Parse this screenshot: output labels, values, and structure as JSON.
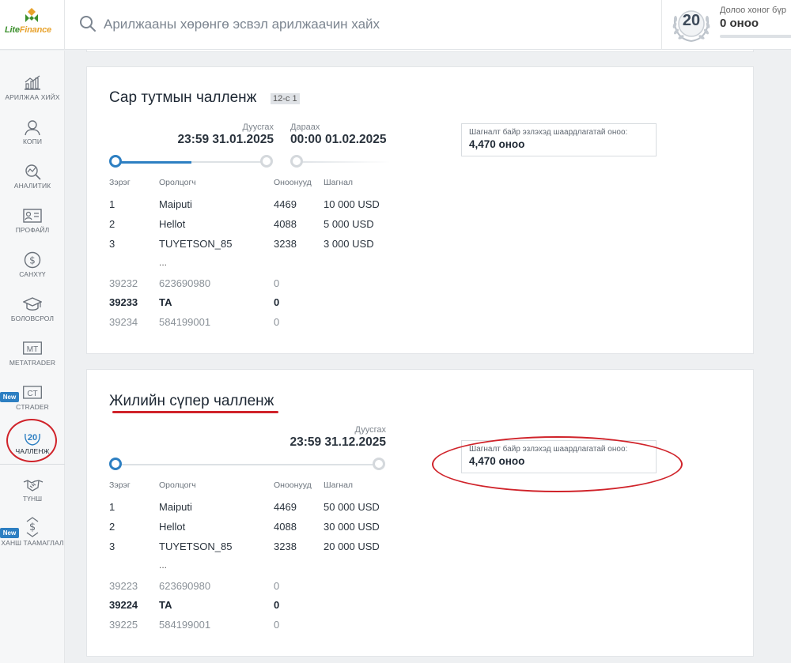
{
  "brand": {
    "logo_word1": "Lite",
    "logo_word2": "Finance"
  },
  "search": {
    "placeholder": "Арилжааны хөрөнгө эсвэл арилжаачин хайх"
  },
  "weekly": {
    "badge_number": "20",
    "label": "Долоо хоног бүр",
    "points": "0 оноо",
    "progress": 0
  },
  "sidebar": {
    "items": [
      {
        "label": "АРИЛЖАА ХИЙХ",
        "icon": "chart-icon"
      },
      {
        "label": "КОПИ",
        "icon": "user-icon"
      },
      {
        "label": "АНАЛИТИК",
        "icon": "analytics-icon"
      },
      {
        "label": "ПРОФАЙЛ",
        "icon": "profile-card-icon"
      },
      {
        "label": "САНХҮҮ",
        "icon": "dollar-icon"
      },
      {
        "label": "БОЛОВСРОЛ",
        "icon": "graduation-cap-icon"
      },
      {
        "label": "METATRADER",
        "icon_text": "MT"
      },
      {
        "label": "CTRADER",
        "icon_text": "CT",
        "badge": "New"
      },
      {
        "label": "ЧАЛЛЕНЖ",
        "icon_text": "20",
        "active": true
      },
      {
        "label": "ТҮНШ",
        "icon": "handshake-icon"
      },
      {
        "label": "ХАНШ ТААМАГЛАЛ",
        "icon": "prediction-icon",
        "badge": "New"
      }
    ]
  },
  "monthly": {
    "title": "Сар тутмын чалленж",
    "level": "12-с 1",
    "end_label": "Дуусгах",
    "end_value": "23:59 31.01.2025",
    "next_label": "Дараах",
    "next_value": "00:00 01.02.2025",
    "progress": 0.5,
    "headers": {
      "rank": "Зэрэг",
      "participant": "Оролцогч",
      "points": "Оноонууд",
      "prize": "Шагнал"
    },
    "top_rows": [
      {
        "rank": "1",
        "name": "Maiputi",
        "points": "4469",
        "prize": "10 000 USD"
      },
      {
        "rank": "2",
        "name": "Hellot",
        "points": "4088",
        "prize": "5 000 USD"
      },
      {
        "rank": "3",
        "name": "TUYETSON_85",
        "points": "3238",
        "prize": "3 000 USD"
      }
    ],
    "ellipsis": "...",
    "around_rows": [
      {
        "rank": "39232",
        "name": "623690980",
        "points": "0",
        "style": "muted"
      },
      {
        "rank": "39233",
        "name": "ТА",
        "points": "0",
        "style": "bold"
      },
      {
        "rank": "39234",
        "name": "584199001",
        "points": "0",
        "style": "muted"
      }
    ],
    "req_label": "Шагналт байр эзлэхэд шаардлагатай оноо:",
    "req_value": "4,470 оноо"
  },
  "yearly": {
    "title": "Жилийн сүпер чалленж",
    "end_label": "Дуусгах",
    "end_value": "23:59 31.12.2025",
    "progress": 0,
    "headers": {
      "rank": "Зэрэг",
      "participant": "Оролцогч",
      "points": "Оноонууд",
      "prize": "Шагнал"
    },
    "top_rows": [
      {
        "rank": "1",
        "name": "Maiputi",
        "points": "4469",
        "prize": "50 000 USD"
      },
      {
        "rank": "2",
        "name": "Hellot",
        "points": "4088",
        "prize": "30 000 USD"
      },
      {
        "rank": "3",
        "name": "TUYETSON_85",
        "points": "3238",
        "prize": "20 000 USD"
      }
    ],
    "ellipsis": "...",
    "around_rows": [
      {
        "rank": "39223",
        "name": "623690980",
        "points": "0",
        "style": "muted"
      },
      {
        "rank": "39224",
        "name": "ТА",
        "points": "0",
        "style": "bold"
      },
      {
        "rank": "39225",
        "name": "584199001",
        "points": "0",
        "style": "muted"
      }
    ],
    "req_label": "Шагналт байр эзлэхэд шаардлагатай оноо:",
    "req_value": "4,470 оноо"
  },
  "colors": {
    "accent": "#2d7fc2",
    "annotation_red": "#d0232a",
    "brand_green": "#3b8f2c"
  }
}
